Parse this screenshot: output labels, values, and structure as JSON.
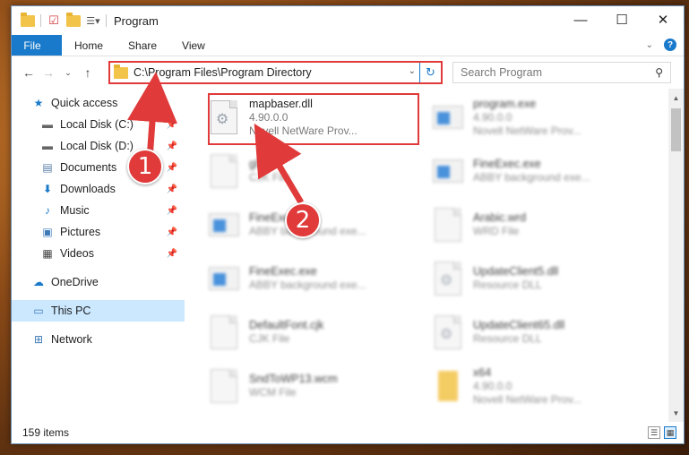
{
  "window": {
    "title": "Program",
    "controls": {
      "minimize": "—",
      "maximize": "☐",
      "close": "✕"
    }
  },
  "ribbon": {
    "tabs": [
      {
        "label": "File"
      },
      {
        "label": "Home"
      },
      {
        "label": "Share"
      },
      {
        "label": "View"
      }
    ],
    "help_label": "?"
  },
  "nav": {
    "address_path": "C:\\Program Files\\Program Directory",
    "search_placeholder": "Search Program"
  },
  "sidebar": {
    "items": [
      {
        "label": "Quick access",
        "icon": "star-icon"
      },
      {
        "label": "Local Disk (C:)",
        "icon": "drive-icon"
      },
      {
        "label": "Local Disk (D:)",
        "icon": "drive-icon"
      },
      {
        "label": "Documents",
        "icon": "documents-icon"
      },
      {
        "label": "Downloads",
        "icon": "download-icon"
      },
      {
        "label": "Music",
        "icon": "music-icon"
      },
      {
        "label": "Pictures",
        "icon": "pictures-icon"
      },
      {
        "label": "Videos",
        "icon": "videos-icon"
      },
      {
        "label": "OneDrive",
        "icon": "cloud-icon"
      },
      {
        "label": "This PC",
        "icon": "pc-icon"
      },
      {
        "label": "Network",
        "icon": "network-icon"
      }
    ]
  },
  "files": [
    {
      "name": "mapbaser.dll",
      "line2": "4.90.0.0",
      "line3": "Novell NetWare Prov...",
      "icon": "dll-gear-icon"
    },
    {
      "name": "program.exe",
      "line2": "4.90.0.0",
      "line3": "Novell NetWare Prov...",
      "icon": "exe-icon"
    },
    {
      "name": "gl.cjk",
      "line2": "CJK File",
      "line3": "",
      "icon": "file-icon"
    },
    {
      "name": "FineExec.exe",
      "line2": "ABBY background exe...",
      "line3": "",
      "icon": "exe-icon"
    },
    {
      "name": "FineExec.exe",
      "line2": "ABBY background exe...",
      "line3": "",
      "icon": "exe-icon"
    },
    {
      "name": "Arabic.wrd",
      "line2": "WRD File",
      "line3": "",
      "icon": "file-icon"
    },
    {
      "name": "FineExec.exe",
      "line2": "ABBY background exe...",
      "line3": "",
      "icon": "exe-icon"
    },
    {
      "name": "UpdateClient5.dll",
      "line2": "Resource DLL",
      "line3": "",
      "icon": "dll-gear-icon"
    },
    {
      "name": "DefaultFont.cjk",
      "line2": "CJK File",
      "line3": "",
      "icon": "file-icon"
    },
    {
      "name": "UpdateClient65.dll",
      "line2": "Resource DLL",
      "line3": "",
      "icon": "dll-gear-icon"
    },
    {
      "name": "SndToWP13.wcm",
      "line2": "WCM File",
      "line3": "",
      "icon": "file-icon"
    },
    {
      "name": "x64",
      "line2": "4.90.0.0",
      "line3": "Novell NetWare Prov...",
      "icon": "folder-icon"
    }
  ],
  "status": {
    "item_count": "159 items"
  },
  "callouts": {
    "step1": "1",
    "step2": "2"
  },
  "colors": {
    "accent": "#1979ca",
    "highlight": "#e03a3a",
    "selection": "#cce8ff"
  }
}
